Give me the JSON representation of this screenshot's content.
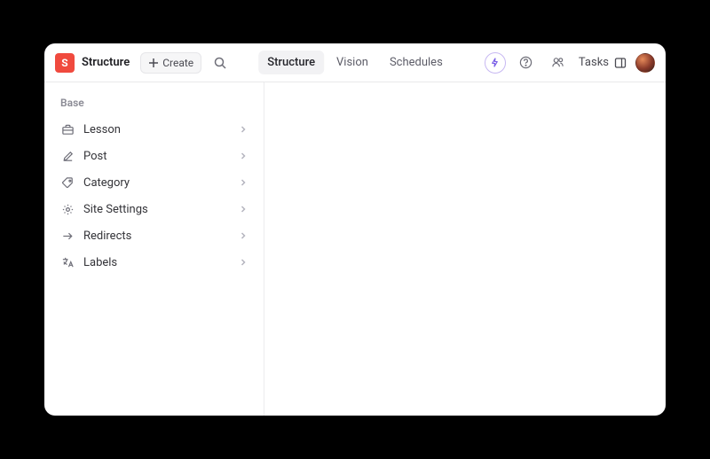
{
  "logo_letter": "S",
  "title": "Structure",
  "create_label": "Create",
  "nav_tabs": [
    {
      "label": "Structure",
      "active": true
    },
    {
      "label": "Vision",
      "active": false
    },
    {
      "label": "Schedules",
      "active": false
    }
  ],
  "tasks_label": "Tasks",
  "sidebar": {
    "section": "Base",
    "items": [
      {
        "icon": "briefcase",
        "label": "Lesson"
      },
      {
        "icon": "edit",
        "label": "Post"
      },
      {
        "icon": "tag",
        "label": "Category"
      },
      {
        "icon": "gear",
        "label": "Site Settings"
      },
      {
        "icon": "arrow-right",
        "label": "Redirects"
      },
      {
        "icon": "translate",
        "label": "Labels"
      }
    ]
  }
}
